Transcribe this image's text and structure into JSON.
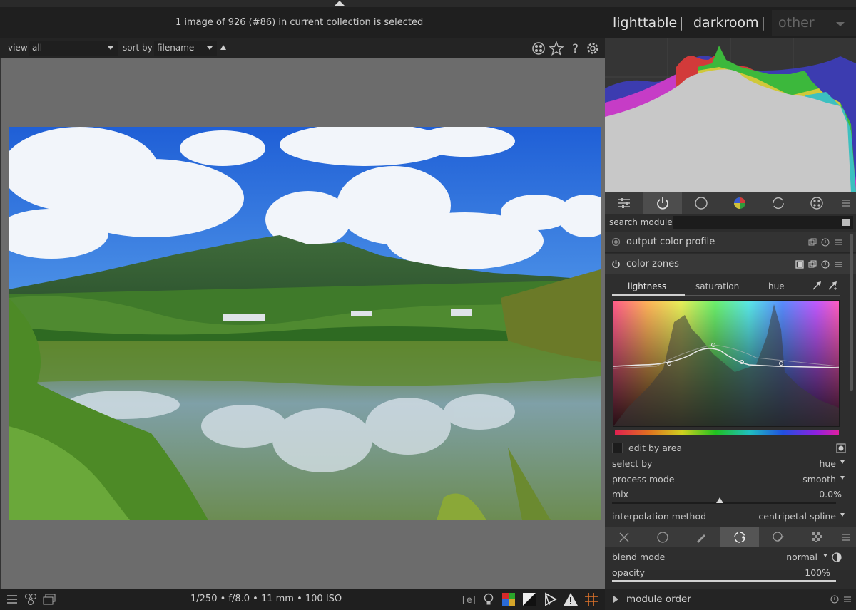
{
  "header": {
    "selection_info": "1 image of 926 (#86) in current collection is selected",
    "views": [
      "lighttable",
      "darkroom",
      "other"
    ],
    "separator": "|"
  },
  "filterbar": {
    "view_label": "view",
    "view_value": "all",
    "sort_label": "sort by",
    "sort_value": "filename",
    "icons": [
      "color-labels-icon",
      "star-icon",
      "help-icon",
      "gear-icon"
    ],
    "help_glyph": "?"
  },
  "bottombar": {
    "exif": "1/250 • f/8.0 • 11 mm • 100 ISO",
    "left_icons": [
      "hamburger-icon",
      "styles-icon",
      "second-window-icon"
    ],
    "right_icons": [
      "raw-overexposed-icon",
      "softproof-icon",
      "gamut-check-icon",
      "clipping-icon",
      "focus-peaking-icon",
      "warning-icon",
      "guides-icon"
    ],
    "raw_glyph": "[e]"
  },
  "modulegroups": {
    "active_index": 1,
    "icons": [
      "presets-icon",
      "power-icon",
      "circle-icon",
      "color-wheel-icon",
      "correct-icon",
      "effects-icon",
      "menu-icon"
    ]
  },
  "search": {
    "label": "search module",
    "value": ""
  },
  "modules": {
    "output_color_profile": "output color profile",
    "color_zones": "color zones"
  },
  "color_zones": {
    "tabs": [
      "lightness",
      "saturation",
      "hue"
    ],
    "active_tab": "lightness",
    "edit_by_area_label": "edit by area",
    "select_by_label": "select by",
    "select_by_value": "hue",
    "process_mode_label": "process mode",
    "process_mode_value": "smooth",
    "mix_label": "mix",
    "mix_value": "0.0%",
    "interp_label": "interpolation method",
    "interp_value": "centripetal spline"
  },
  "blend": {
    "active_index": 3,
    "icons": [
      "off-icon",
      "uniform-icon",
      "drawn-mask-icon",
      "parametric-mask-icon",
      "drawn-parametric-icon",
      "raster-mask-icon",
      "menu-icon"
    ],
    "blend_mode_label": "blend mode",
    "blend_mode_value": "normal",
    "opacity_label": "opacity",
    "opacity_value": "100%"
  },
  "module_order": {
    "label": "module order"
  },
  "colors": {
    "panel_bg": "#2c2c2c",
    "center_bg": "#6c6c6c",
    "header_bg": "#1f1f1f",
    "text": "#c8c8c8"
  }
}
